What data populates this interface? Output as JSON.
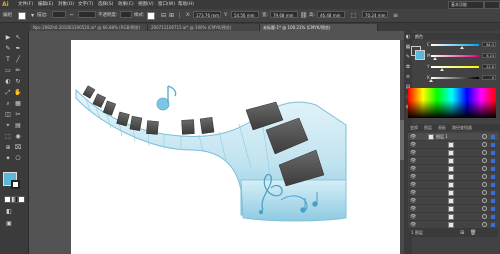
{
  "app": {
    "logo": "Ai"
  },
  "menu": {
    "items": [
      "文件(F)",
      "编辑(E)",
      "对象(O)",
      "文字(T)",
      "选择(S)",
      "效果(C)",
      "视图(V)",
      "窗口(W)",
      "帮助(H)"
    ],
    "workspace": "基本功能"
  },
  "controlbar": {
    "group_label": "编组",
    "fill_label": "",
    "stroke_label": "描边:",
    "opacity_label": "不透明度:",
    "style_label": "样式:",
    "x_label": "X:",
    "x_value": "173.76 mm",
    "y_label": "Y:",
    "y_value": "54.56 mm",
    "w_label": "宽:",
    "w_value": "79.68 mm",
    "h_label": "高:",
    "h_value": "46.48 mm",
    "extra_value": "70.24 mm"
  },
  "tabs": [
    {
      "label": "Npc-2982h0.201003190520.ai* @ 66.88% (RGB/预览)",
      "active": false
    },
    {
      "label": "200711106715.ai* @ 100% (CMYK/预览)",
      "active": false
    },
    {
      "label": "未标题-1* @ 100.21% (CMYK/预览)",
      "active": true
    }
  ],
  "tools": [
    "▶",
    "↖",
    "✎",
    "✒",
    "T",
    "╱",
    "▭",
    "✏",
    "◐",
    "↻",
    "⤢",
    "✋",
    "⌕",
    "▦",
    "◫",
    "✂",
    "⌖",
    "▤",
    "⬚",
    "◉",
    "⊕",
    "⌧",
    "✦",
    "⎔"
  ],
  "color_panel": {
    "tab_label": "颜色",
    "sliders": [
      {
        "label": "C",
        "value": "64.3",
        "percent": 0.64,
        "color_from": "#ffffff",
        "color_to": "#00a0e9"
      },
      {
        "label": "M",
        "value": "9.24",
        "percent": 0.09,
        "color_from": "#ffffff",
        "color_to": "#e4007f"
      },
      {
        "label": "Y",
        "value": "22.6",
        "percent": 0.23,
        "color_from": "#ffffff",
        "color_to": "#fff100"
      },
      {
        "label": "K",
        "value": "0",
        "percent": 0.0,
        "color_from": "#ffffff",
        "color_to": "#000000"
      }
    ],
    "fill_color": "#5bb8d6",
    "stroke_color": "#ffffff"
  },
  "layers_panel": {
    "tabs": [
      "变换",
      "图层",
      "画板",
      "路径查找器"
    ],
    "active_tab": "图层",
    "rows": [
      {
        "name": "图层 1",
        "expanded": true
      },
      {
        "name": "",
        "expanded": false
      },
      {
        "name": "",
        "expanded": false
      },
      {
        "name": "",
        "expanded": false
      },
      {
        "name": "",
        "expanded": false
      },
      {
        "name": "",
        "expanded": false
      },
      {
        "name": "",
        "expanded": false
      },
      {
        "name": "",
        "expanded": false
      },
      {
        "name": "",
        "expanded": false
      },
      {
        "name": "",
        "expanded": false
      },
      {
        "name": "",
        "expanded": false
      },
      {
        "name": "",
        "expanded": false
      }
    ],
    "footer": "1 图层"
  },
  "artwork": {
    "light_blue": "#cfe9f3",
    "mid_blue": "#9ed3e6",
    "deep_blue": "#5aaed0",
    "key_dark": "#4a4a4a",
    "note_color": "#7cc6e3"
  }
}
